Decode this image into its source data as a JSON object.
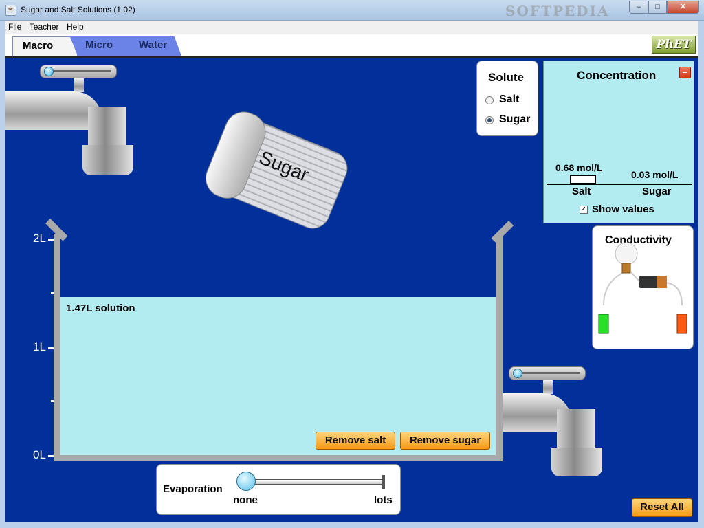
{
  "window": {
    "title": "Sugar and Salt Solutions (1.02)",
    "watermark": "SOFTPEDIA",
    "controls": {
      "minimize": "–",
      "maximize": "□",
      "close": "✕"
    }
  },
  "menu": {
    "items": [
      "File",
      "Teacher",
      "Help"
    ]
  },
  "tabs": [
    {
      "label": "Macro",
      "selected": true
    },
    {
      "label": "Micro",
      "selected": false
    },
    {
      "label": "Water",
      "selected": false
    }
  ],
  "logo": {
    "text": "PhET"
  },
  "shaker": {
    "label": "Sugar"
  },
  "beaker": {
    "solution_label": "1.47L solution",
    "solution_volume_l": 1.47,
    "max_volume_l": 2,
    "ticks": [
      "2L",
      "1L",
      "0L"
    ]
  },
  "buttons": {
    "remove_salt": "Remove salt",
    "remove_sugar": "Remove sugar",
    "reset_all": "Reset All"
  },
  "solute": {
    "title": "Solute",
    "options": [
      {
        "label": "Salt",
        "selected": false
      },
      {
        "label": "Sugar",
        "selected": true
      }
    ]
  },
  "concentration": {
    "title": "Concentration",
    "close_symbol": "–",
    "bars": [
      {
        "label": "Salt",
        "value_text": "0.68 mol/L",
        "value": 0.68
      },
      {
        "label": "Sugar",
        "value_text": "0.03 mol/L",
        "value": 0.03
      }
    ],
    "show_values_label": "Show values",
    "show_values_checked": true
  },
  "conductivity": {
    "title": "Conductivity"
  },
  "evaporation": {
    "label": "Evaporation",
    "min_label": "none",
    "max_label": "lots",
    "level": 0
  },
  "faucets": {
    "input_flow": 0,
    "output_flow": 0
  },
  "colors": {
    "canvas": "#02309a",
    "solution": "#b3ecf0",
    "button": "#f59a16"
  }
}
